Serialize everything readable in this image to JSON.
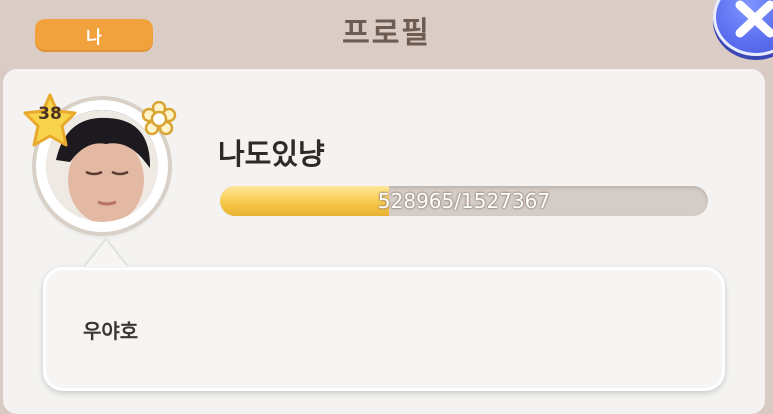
{
  "header": {
    "tab_label": "나",
    "title": "프로필",
    "accent_color": "#f2a23c",
    "close_icon": "close-x-icon"
  },
  "profile": {
    "level": "38",
    "nickname": "나도있냥",
    "exp_text": "528965/1527367",
    "exp_fraction": 0.3463,
    "status_message": "우야호",
    "badge_icon": "flower-icon"
  }
}
